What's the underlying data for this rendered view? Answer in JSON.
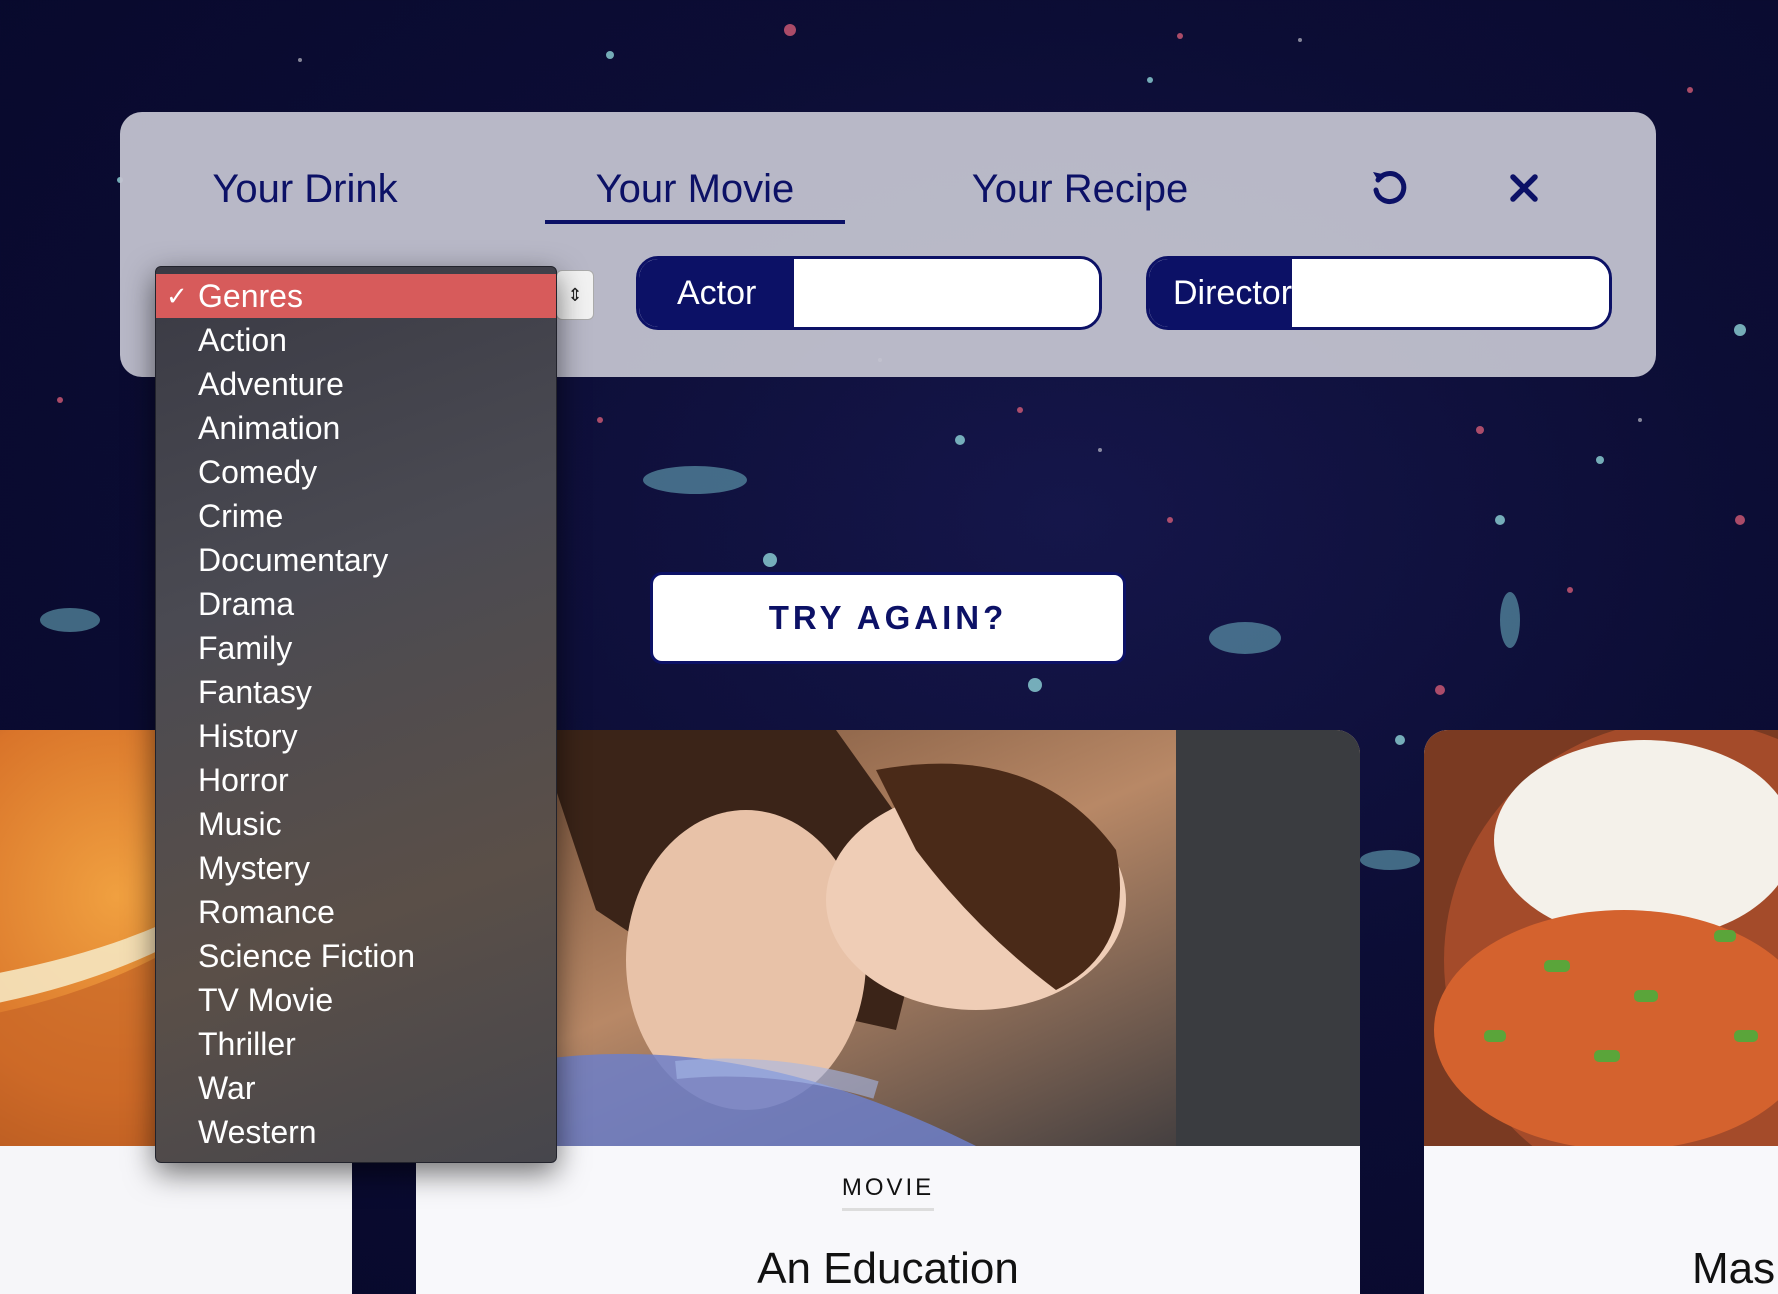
{
  "tabs": [
    {
      "label": "Your Drink"
    },
    {
      "label": "Your Movie",
      "active": true
    },
    {
      "label": "Your Recipe"
    }
  ],
  "icons": {
    "reset": "rotate-ccw-icon",
    "close": "close-icon",
    "check": "checkmark-icon"
  },
  "filters": {
    "genre_selected": "Genres",
    "actor": {
      "label": "Actor",
      "value": ""
    },
    "director": {
      "label": "Director",
      "value": ""
    }
  },
  "genre_dropdown": {
    "check_glyph": "✓",
    "options": [
      "Genres",
      "Action",
      "Adventure",
      "Animation",
      "Comedy",
      "Crime",
      "Documentary",
      "Drama",
      "Family",
      "Fantasy",
      "History",
      "Horror",
      "Music",
      "Mystery",
      "Romance",
      "Science Fiction",
      "TV Movie",
      "Thriller",
      "War",
      "Western"
    ]
  },
  "try_again": {
    "label": "TRY AGAIN?"
  },
  "movie_card": {
    "category": "MOVIE",
    "title": "An Education"
  },
  "recipe_card": {
    "title": "Mas"
  },
  "colors": {
    "navy": "#0c1166",
    "selected": "#d75b5b",
    "panel": "#c4c4d0"
  }
}
